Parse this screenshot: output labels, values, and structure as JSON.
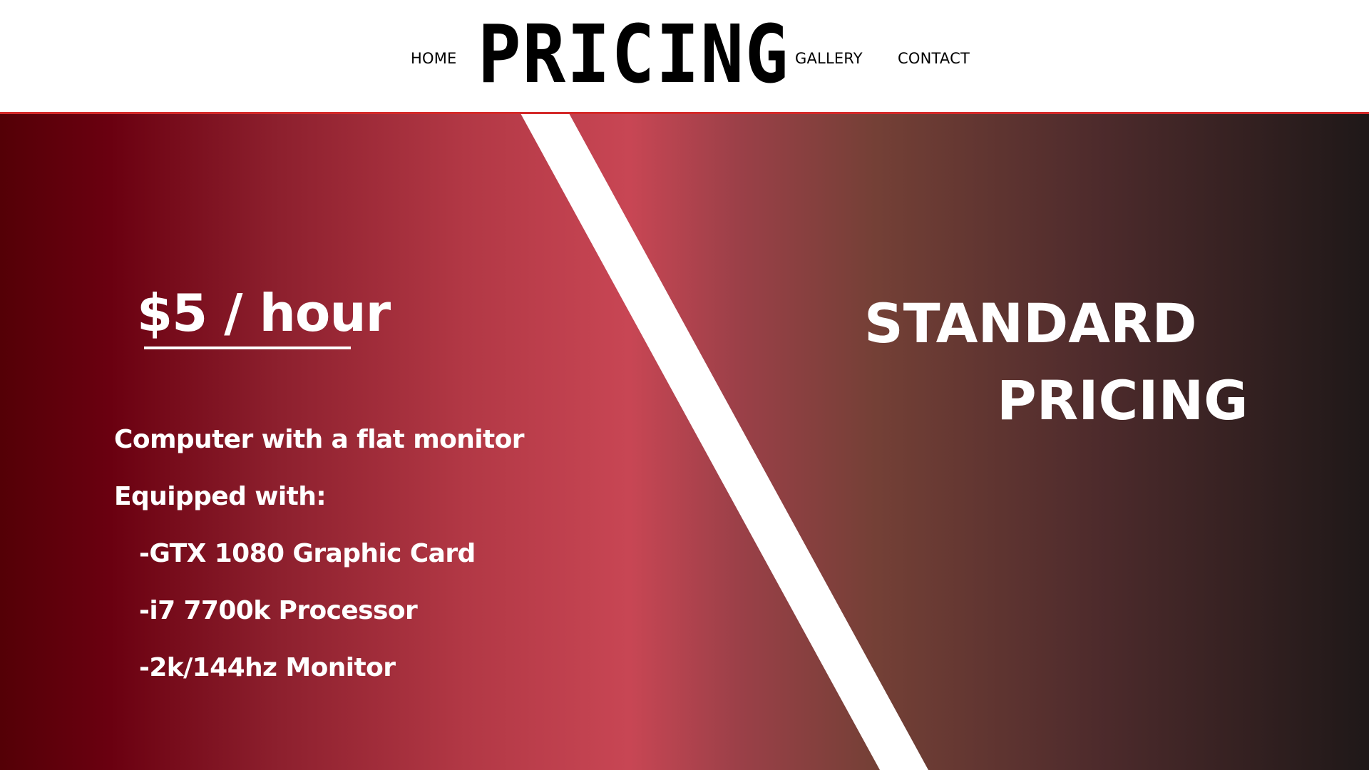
{
  "nav": {
    "home": "HOME",
    "logo": "PRICING",
    "gallery": "GALLERY",
    "contact": "CONTACT"
  },
  "pricing": {
    "price": "$5 / hour",
    "features": [
      "Computer with a flat monitor",
      "Equipped with:",
      "-GTX 1080 Graphic Card",
      "-i7 7700k Processor",
      "-2k/144hz Monitor"
    ],
    "title_line1": "STANDARD",
    "title_line2": "PRICING"
  },
  "colors": {
    "accent": "#d42a2a",
    "gradient_dark_red": "#540006",
    "gradient_mid_red": "#c84654",
    "gradient_dark": "#1f1818",
    "text": "#ffffff"
  }
}
